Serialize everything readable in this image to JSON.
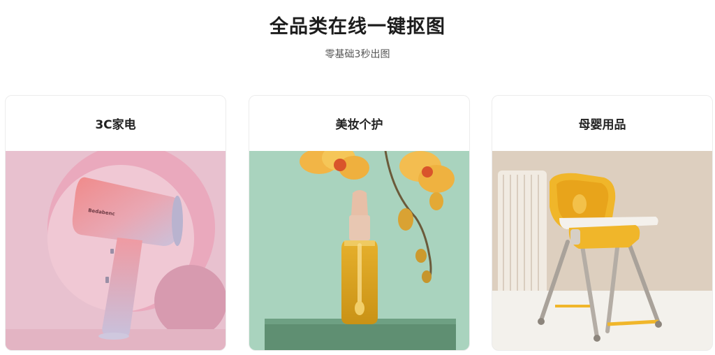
{
  "header": {
    "title": "全品类在线一键抠图",
    "subtitle": "零基础3秒出图"
  },
  "categories": [
    {
      "label": "3C家电",
      "image_icon": "hair-dryer-image"
    },
    {
      "label": "美妆个护",
      "image_icon": "serum-bottle-orchid-image"
    },
    {
      "label": "母婴用品",
      "image_icon": "baby-high-chair-image"
    }
  ],
  "product_text": {
    "dryer_brand": "Bedabenc"
  },
  "colors": {
    "card_1_bg": "#e8b9c8",
    "card_2_bg": "#a9d3be",
    "card_3_bg": "#efe7dc",
    "accent_yellow": "#f0b62a"
  }
}
